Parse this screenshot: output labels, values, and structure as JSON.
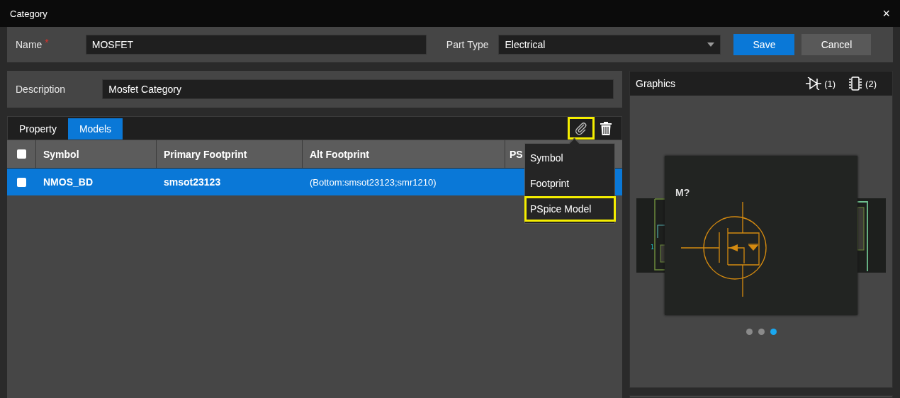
{
  "window": {
    "title": "Category",
    "close": "×"
  },
  "name_field": {
    "label": "Name",
    "required_mark": "*",
    "value": "MOSFET"
  },
  "part_type": {
    "label": "Part Type",
    "value": "Electrical"
  },
  "buttons": [
    {
      "label": "Save",
      "kind": "primary"
    },
    {
      "label": "Cancel",
      "kind": "secondary"
    }
  ],
  "description": {
    "label": "Description",
    "value": "Mosfet Category"
  },
  "tabs": [
    {
      "label": "Property",
      "selected": false
    },
    {
      "label": "Models",
      "selected": true
    }
  ],
  "toolbar": {
    "attach_highlighted": true
  },
  "table": {
    "header_checked": false,
    "columns": [
      "Symbol",
      "Primary Footprint",
      "Alt Footprint",
      "PS"
    ],
    "rows": [
      {
        "checked": false,
        "selected": true,
        "cells": [
          "NMOS_BD",
          "smsot23123",
          "(Bottom:smsot23123;smr1210)"
        ]
      }
    ]
  },
  "attach_menu": [
    {
      "label": "Symbol",
      "highlighted": false
    },
    {
      "label": "Footprint",
      "highlighted": false
    },
    {
      "label": "PSpice Model",
      "highlighted": true
    }
  ],
  "graphics": {
    "title": "Graphics",
    "symbol_count": "(1)",
    "footprint_count": "(2)",
    "card_label": "M?",
    "pin_label": "1",
    "dots": [
      {
        "selected": false
      },
      {
        "selected": false
      },
      {
        "selected": true
      }
    ]
  }
}
